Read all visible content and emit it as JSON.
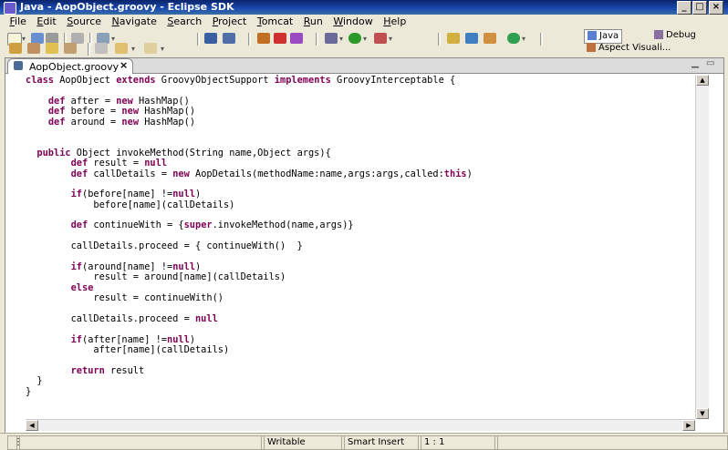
{
  "window": {
    "title": "Java - AopObject.groovy - Eclipse SDK"
  },
  "menu": [
    "File",
    "Edit",
    "Source",
    "Navigate",
    "Search",
    "Project",
    "Tomcat",
    "Run",
    "Window",
    "Help"
  ],
  "perspectives": [
    {
      "label": "Java",
      "active": true
    },
    {
      "label": "Debug",
      "active": false
    },
    {
      "label": "Aspect Visuali...",
      "active": false
    }
  ],
  "editor": {
    "tab_label": "AopObject.groovy",
    "code": [
      [
        [
          "class",
          "kw"
        ],
        [
          " AopObject ",
          ""
        ],
        [
          "extends",
          "kw"
        ],
        [
          " GroovyObjectSupport ",
          ""
        ],
        [
          "implements",
          "kw"
        ],
        [
          " GroovyInterceptable {",
          ""
        ]
      ],
      [],
      [
        [
          "    ",
          ""
        ],
        [
          "def",
          "kw"
        ],
        [
          " after = ",
          ""
        ],
        [
          "new",
          "kw"
        ],
        [
          " HashMap()",
          ""
        ]
      ],
      [
        [
          "    ",
          ""
        ],
        [
          "def",
          "kw"
        ],
        [
          " before = ",
          ""
        ],
        [
          "new",
          "kw"
        ],
        [
          " HashMap()",
          ""
        ]
      ],
      [
        [
          "    ",
          ""
        ],
        [
          "def",
          "kw"
        ],
        [
          " around = ",
          ""
        ],
        [
          "new",
          "kw"
        ],
        [
          " HashMap()",
          ""
        ]
      ],
      [],
      [],
      [
        [
          "  ",
          ""
        ],
        [
          "public",
          "kw"
        ],
        [
          " Object invokeMethod(String name,Object args){",
          ""
        ]
      ],
      [
        [
          "        ",
          ""
        ],
        [
          "def",
          "kw"
        ],
        [
          " result = ",
          ""
        ],
        [
          "null",
          "kw"
        ]
      ],
      [
        [
          "        ",
          ""
        ],
        [
          "def",
          "kw"
        ],
        [
          " callDetails = ",
          ""
        ],
        [
          "new",
          "kw"
        ],
        [
          " AopDetails(methodName:name,args:args,called:",
          ""
        ],
        [
          "this",
          "kw"
        ],
        [
          ")",
          ""
        ]
      ],
      [],
      [
        [
          "        ",
          ""
        ],
        [
          "if",
          "kw"
        ],
        [
          "(before[name] !=",
          ""
        ],
        [
          "null",
          "kw"
        ],
        [
          ")",
          ""
        ]
      ],
      [
        [
          "            before[name](callDetails)",
          ""
        ]
      ],
      [],
      [
        [
          "        ",
          ""
        ],
        [
          "def",
          "kw"
        ],
        [
          " continueWith = {",
          ""
        ],
        [
          "super",
          "kw"
        ],
        [
          ".invokeMethod(name,args)}",
          ""
        ]
      ],
      [],
      [
        [
          "        callDetails.proceed = { continueWith()  }",
          ""
        ]
      ],
      [],
      [
        [
          "        ",
          ""
        ],
        [
          "if",
          "kw"
        ],
        [
          "(around[name] !=",
          ""
        ],
        [
          "null",
          "kw"
        ],
        [
          ")",
          ""
        ]
      ],
      [
        [
          "            result = around[name](callDetails)",
          ""
        ]
      ],
      [
        [
          "        ",
          ""
        ],
        [
          "else",
          "kw"
        ]
      ],
      [
        [
          "            result = continueWith()",
          ""
        ]
      ],
      [],
      [
        [
          "        callDetails.proceed = ",
          ""
        ],
        [
          "null",
          "kw"
        ]
      ],
      [],
      [
        [
          "        ",
          ""
        ],
        [
          "if",
          "kw"
        ],
        [
          "(after[name] !=",
          ""
        ],
        [
          "null",
          "kw"
        ],
        [
          ")",
          ""
        ]
      ],
      [
        [
          "            after[name](callDetails)",
          ""
        ]
      ],
      [],
      [
        [
          "        ",
          ""
        ],
        [
          "return",
          "kw"
        ],
        [
          " result",
          ""
        ]
      ],
      [
        [
          "  }",
          ""
        ]
      ],
      [
        [
          "}",
          ""
        ]
      ]
    ]
  },
  "status": {
    "mode": "Writable",
    "insert": "Smart Insert",
    "position": "1 : 1"
  }
}
